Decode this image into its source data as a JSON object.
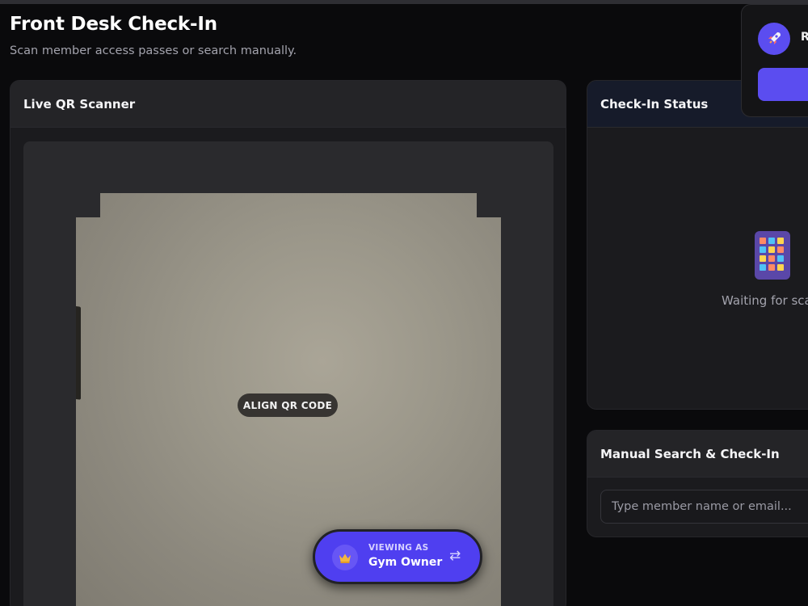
{
  "header": {
    "title": "Front Desk Check-In",
    "subtitle": "Scan member access passes or search manually."
  },
  "scanner": {
    "title": "Live QR Scanner",
    "hint": "ALIGN QR CODE"
  },
  "status": {
    "title": "Check-In Status",
    "waiting_text": "Waiting for sca",
    "icon": "tablet-grid-icon"
  },
  "search": {
    "title": "Manual Search & Check-In",
    "placeholder": "Type member name or email..."
  },
  "viewing_as": {
    "label": "VIEWING AS",
    "role": "Gym Owner",
    "icon": "crown-icon",
    "switch_icon": "⇄"
  },
  "toast": {
    "text": "R",
    "icon": "rocket-icon"
  },
  "colors": {
    "accent": "#4f3ff0",
    "background": "#0a0a0c",
    "panel": "#1b1b1e"
  }
}
